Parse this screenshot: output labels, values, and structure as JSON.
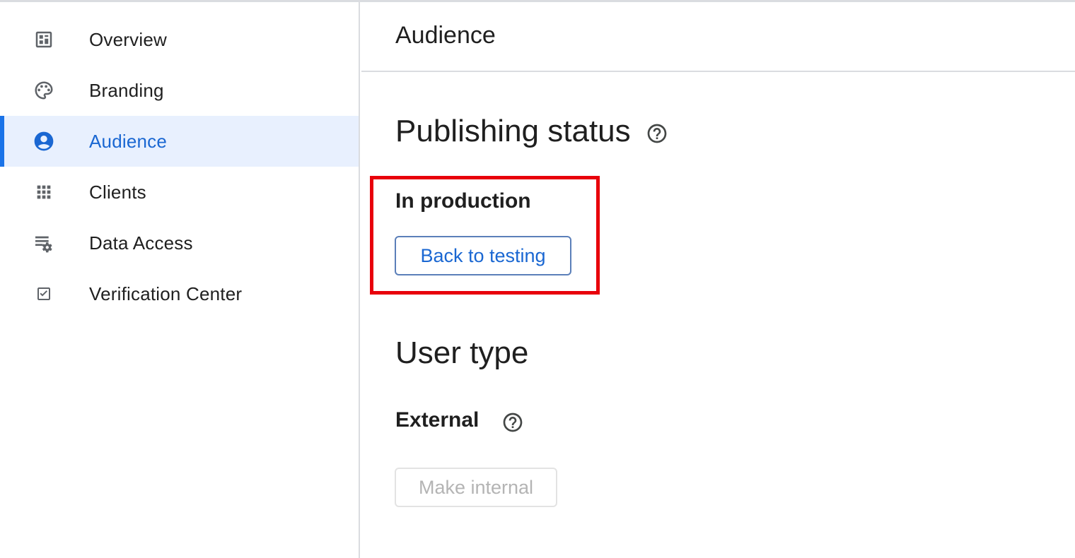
{
  "sidebar": {
    "items": [
      {
        "label": "Overview",
        "icon": "dashboard-icon",
        "active": false
      },
      {
        "label": "Branding",
        "icon": "palette-icon",
        "active": false
      },
      {
        "label": "Audience",
        "icon": "account-circle-icon",
        "active": true
      },
      {
        "label": "Clients",
        "icon": "apps-grid-icon",
        "active": false
      },
      {
        "label": "Data Access",
        "icon": "list-settings-icon",
        "active": false
      },
      {
        "label": "Verification Center",
        "icon": "checkbox-icon",
        "active": false
      }
    ]
  },
  "header": {
    "title": "Audience"
  },
  "publishing": {
    "section_title": "Publishing status",
    "status": "In production",
    "button_label": "Back to testing"
  },
  "user_type": {
    "section_title": "User type",
    "value": "External",
    "button_label": "Make internal"
  },
  "colors": {
    "accent": "#1a73e8",
    "active_bg": "#e8f0fe",
    "highlight": "#e8000b"
  }
}
